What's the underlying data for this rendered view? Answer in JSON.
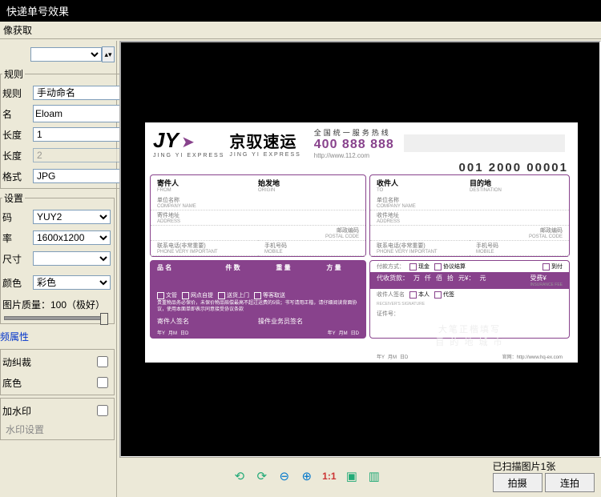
{
  "title": "快递单号效果",
  "menu": {
    "capture": "像获取"
  },
  "side": {
    "blank_select": "",
    "rules_group": "规则",
    "rule_label": "规则",
    "rule_value": "手动命名",
    "name_label": "名",
    "name_value": "Eloam",
    "len1_label": "长度",
    "len1_value": "1",
    "len2_label": "长度",
    "len2_value": "2",
    "format_label": "格式",
    "format_value": "JPG",
    "settings_group": "设置",
    "code_label": "码",
    "code_value": "YUY2",
    "rate_label": "率",
    "rate_value": "1600x1200",
    "size_label": "尺寸",
    "color_label": "颜色",
    "color_value": "彩色",
    "quality_label": "图片质量：100（极好）",
    "adv_link": "频属性",
    "crop_label": "动纠裁",
    "base_label": "底色",
    "wm_label": "加水印",
    "wm_link": "水印设置"
  },
  "waybill": {
    "logo_en": "JY",
    "logo_sub": "JING YI EXPRESS",
    "logo_cn": "京驭速运",
    "logo_cn_sub": "JING YI EXPRESS",
    "hotline_label": "全国统一服务热线",
    "hotline_num": "400 888 888",
    "hotline_url": "http://www.112.com",
    "awb_no": "001 2000 00001",
    "sender_title": "寄件人",
    "sender_sub": "FROM",
    "origin_title": "始发地",
    "origin_sub": "ORIGIN",
    "recipient_title": "收件人",
    "recipient_sub": "TO",
    "dest_title": "目的地",
    "dest_sub": "DESTINATION",
    "company_label": "单位名称",
    "company_sub": "COMPANY NAME",
    "addr_label": "寄件地址",
    "addr_label2": "收件地址",
    "addr_sub": "ADDRESS",
    "post_label": "邮政编码",
    "post_sub": "POSTAL CODE",
    "phone_label": "联系电话(非常重要)",
    "phone_sub": "PHONE VERY IMPORTANT",
    "mobile_label": "手机号码",
    "mobile_sub": "MOBILE",
    "goods_name": "品 名",
    "goods_qty": "件 数",
    "goods_wt": "重 量",
    "goods_vol": "方 量",
    "svc_1": "文管",
    "svc_2": "网点自提",
    "svc_3": "送货上门",
    "svc_4": "等客取送",
    "disclaimer": "贵重物品务必保价，未保价物品赔偿最高不超过运费的5倍；书写请用正楷，请仔细阅读背面协议，使用本面单即表示同意接受协议条款",
    "sig_sender": "寄件人签名",
    "sig_op": "操件业务员签名",
    "foot_y": "年Y",
    "foot_m": "月M",
    "foot_d": "日D",
    "pay_method": "付款方式：",
    "pay_cash": "现金",
    "pay_transfer": "协议结算",
    "pay_cod_chk": "到付",
    "cod_label": "代收货款：",
    "cod_wan": "万",
    "cod_qian": "仟",
    "cod_bai": "佰",
    "cod_shi": "拾",
    "cod_yuan_u": "元¥：",
    "cod_yuan": "元",
    "ins_label": "受费¥",
    "ins_sub": "INSURANCE FEE",
    "recv_sig": "收件人签名",
    "recv_self": "本人",
    "recv_agent": "代签",
    "recv_sub": "RECEIVER'S SIGNATURE",
    "id_label": "证件号：",
    "ghost1": "大笔正楷填写",
    "ghost2": "目 的 地 城 市",
    "site_label": "官网：",
    "site_url": "http://www.hq-ex.com"
  },
  "toolbar": {
    "scanned": "已扫描图片1张",
    "btn_shoot": "拍摄",
    "btn_cont": "连拍",
    "ratio": "1:1"
  }
}
